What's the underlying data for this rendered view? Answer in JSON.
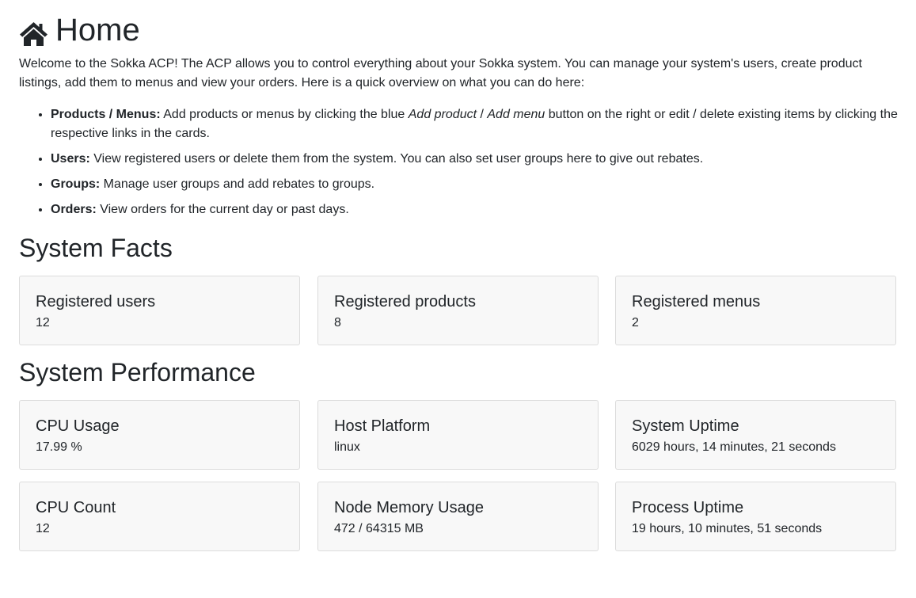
{
  "header": {
    "title": "Home",
    "icon": "home-icon"
  },
  "intro": "Welcome to the Sokka ACP! The ACP allows you to control everything about your Sokka system. You can manage your system's users, create product listings, add them to menus and view your orders. Here is a quick overview on what you can do here:",
  "features": [
    {
      "label": "Products / Menus:",
      "text_before": " Add products or menus by clicking the blue ",
      "em1": "Add product",
      "sep": " / ",
      "em2": "Add menu",
      "text_after": " button on the right or edit / delete existing items by clicking the respective links in the cards."
    },
    {
      "label": "Users:",
      "text": " View registered users or delete them from the system. You can also set user groups here to give out rebates."
    },
    {
      "label": "Groups:",
      "text": " Manage user groups and add rebates to groups."
    },
    {
      "label": "Orders:",
      "text": " View orders for the current day or past days."
    }
  ],
  "system_facts": {
    "heading": "System Facts",
    "cards": [
      {
        "title": "Registered users",
        "value": "12"
      },
      {
        "title": "Registered products",
        "value": "8"
      },
      {
        "title": "Registered menus",
        "value": "2"
      }
    ]
  },
  "system_performance": {
    "heading": "System Performance",
    "cards": [
      {
        "title": "CPU Usage",
        "value": "17.99 %"
      },
      {
        "title": "Host Platform",
        "value": "linux"
      },
      {
        "title": "System Uptime",
        "value": "6029 hours, 14 minutes, 21 seconds"
      },
      {
        "title": "CPU Count",
        "value": "12"
      },
      {
        "title": "Node Memory Usage",
        "value": "472 / 64315 MB"
      },
      {
        "title": "Process Uptime",
        "value": "19 hours, 10 minutes, 51 seconds"
      }
    ]
  }
}
